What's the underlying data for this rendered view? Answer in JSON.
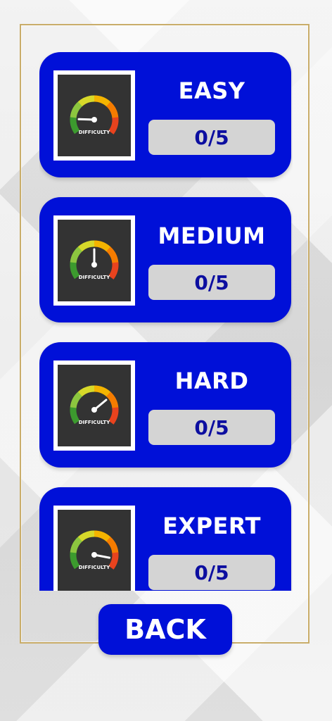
{
  "levels": [
    {
      "title": "EASY",
      "score": "0/5",
      "gauge_label": "DIFFICULTY",
      "needle_level": 0.15
    },
    {
      "title": "MEDIUM",
      "score": "0/5",
      "gauge_label": "DIFFICULTY",
      "needle_level": 0.5
    },
    {
      "title": "HARD",
      "score": "0/5",
      "gauge_label": "DIFFICULTY",
      "needle_level": 0.7
    },
    {
      "title": "EXPERT",
      "score": "0/5",
      "gauge_label": "DIFFICULTY",
      "needle_level": 0.9
    }
  ],
  "back_label": "BACK",
  "colors": {
    "card": "#0010d8",
    "score_box": "#d4d4d4",
    "score_text": "#0c0ea0",
    "frame": "#c9ad6a",
    "icon_bg": "#333333"
  },
  "icons": {
    "gauge": "difficulty-gauge-icon"
  }
}
